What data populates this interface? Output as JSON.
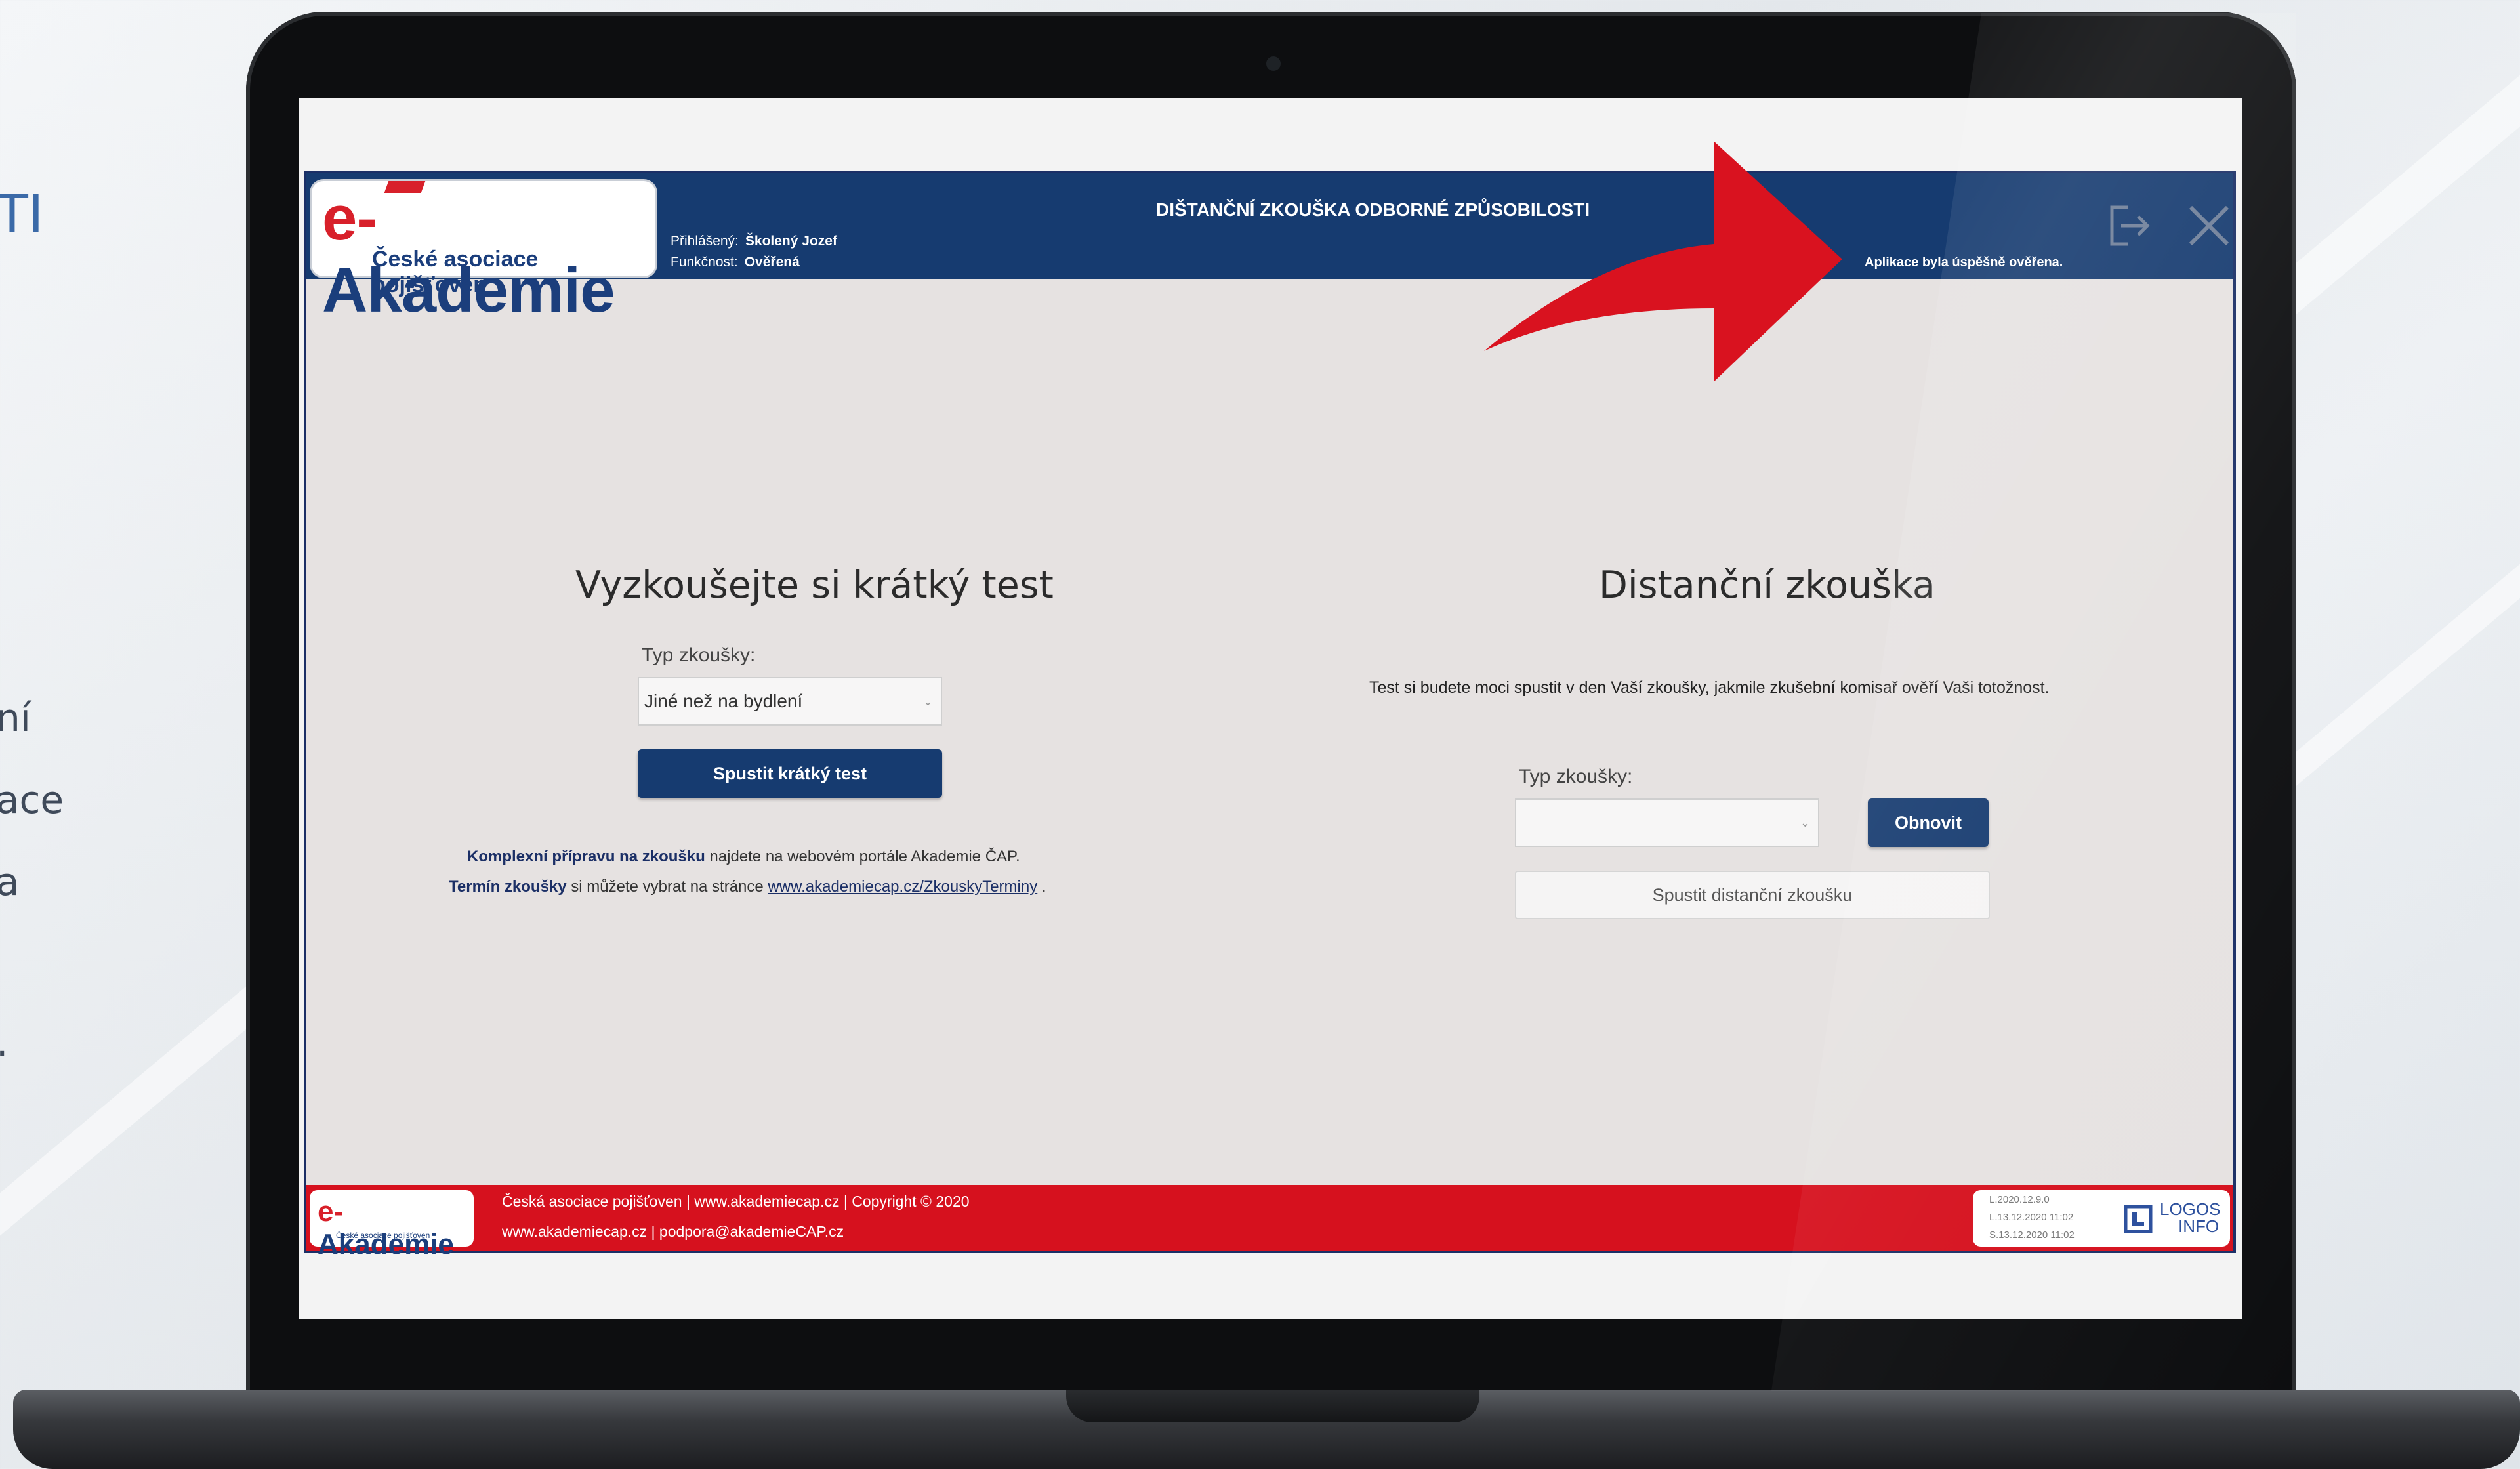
{
  "slide": {
    "fragments": [
      "TI",
      "ní",
      "ace",
      "a",
      "."
    ]
  },
  "header": {
    "logo_main": "e-Akademie",
    "logo_sub": "České asociace pojišťoven",
    "user_label": "Přihlášený:",
    "user_name": "Školený Jozef",
    "role_label": "Funkčnost:",
    "role_value": "Ověřená",
    "title": "DIŠTANČNÍ ZKOUŠKA ODBORNÉ ZPŮSOBILOSTI",
    "status": "Aplikace byla úspěšně ověřena.",
    "exit_icon": "logout-icon",
    "close_icon": "close-icon"
  },
  "short_test": {
    "heading": "Vyzkoušejte si krátký test",
    "type_label": "Typ zkoušky:",
    "type_value": "Jiné než na bydlení",
    "start_button": "Spustit krátký test",
    "info1_bold": "Komplexní přípravu na zkoušku",
    "info1_text": " najdete na webovém portále  Akademie ČAP.",
    "info2_bold": "Termín zkoušky",
    "info2_text": "  si můžete vybrat na stránce ",
    "info2_link": "www.akademiecap.cz/ZkouskyTerminy",
    "info2_end": " ."
  },
  "distance_exam": {
    "heading": "Distanční zkouška",
    "description": "Test si budete moci spustit v den Vaší zkoušky, jakmile zkušební komisař ověří Vaši totožnost.",
    "type_label": "Typ zkoušky:",
    "type_value": "",
    "refresh_button": "Obnovit",
    "start_button": "Spustit distanční zkoušku"
  },
  "footer": {
    "logo_main": "e-Akademie",
    "logo_sub": "České asociace pojišťoven",
    "line1": "Česká asociace pojišťoven |  www.akademiecap.cz  | Copyright © 2020",
    "line2": "www.akademiecap.cz  |  podpora@akademieCAP.cz",
    "versions": [
      "L.2020.12.9.0",
      "L.13.12.2020 11:02",
      "S.13.12.2020 11:02"
    ],
    "vendor": "LOGOS",
    "vendor_sub": "INFO"
  },
  "colors": {
    "header_bg": "#163b70",
    "footer_bg": "#d6111e",
    "app_bg": "#e6e2e1",
    "annotation_arrow": "#d9121f"
  }
}
